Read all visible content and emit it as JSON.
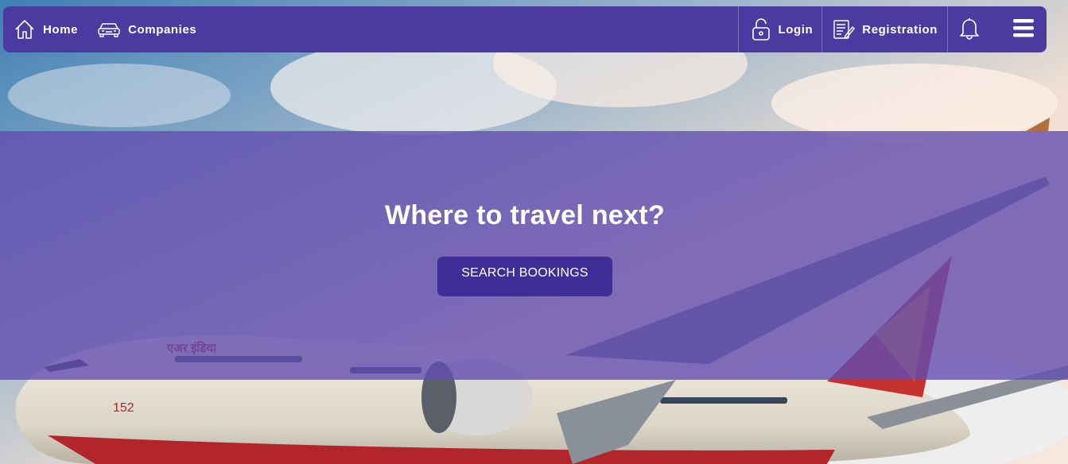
{
  "nav": {
    "home_label": "Home",
    "companies_label": "Companies",
    "login_label": "Login",
    "registration_label": "Registration"
  },
  "hero": {
    "headline": "Where to travel next?",
    "button_label": "SEARCH BOOKINGS",
    "aircraft_number": "152"
  },
  "colors": {
    "navbar": "#4b3ba0",
    "band_overlay": "#634eb0",
    "button": "#3f2e97"
  },
  "icons": [
    "home-icon",
    "car-icon",
    "lock-icon",
    "registration-icon",
    "bell-icon",
    "menu-icon"
  ]
}
